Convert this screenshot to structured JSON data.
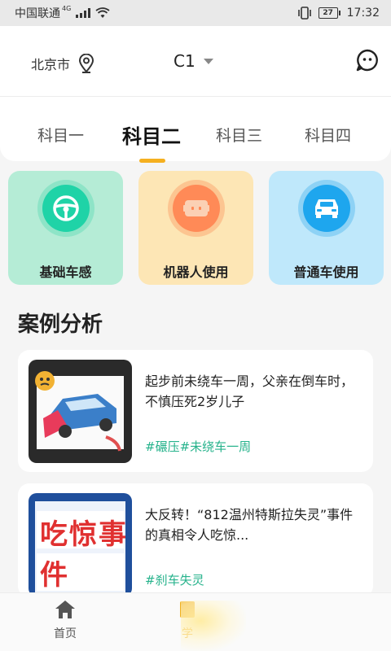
{
  "status_bar": {
    "carrier": "中国联通",
    "network": "4G",
    "battery": "27",
    "time": "17:32"
  },
  "header": {
    "city": "北京市",
    "license_type": "C1",
    "icons": {
      "location": "location-pin-icon",
      "dropdown": "caret-down-icon",
      "chat": "chat-bubble-icon"
    }
  },
  "tabs": [
    {
      "label": "科目一",
      "active": false
    },
    {
      "label": "科目二",
      "active": true
    },
    {
      "label": "科目三",
      "active": false
    },
    {
      "label": "科目四",
      "active": false
    }
  ],
  "categories": [
    {
      "label": "基础车感",
      "icon": "steering-wheel-icon",
      "color": "#1fd3a7"
    },
    {
      "label": "机器人使用",
      "icon": "robot-icon",
      "color": "#ff8a57"
    },
    {
      "label": "普通车使用",
      "icon": "car-icon",
      "color": "#1ea6ee"
    }
  ],
  "section": {
    "title": "案例分析"
  },
  "articles": [
    {
      "title": "起步前未绕车一周，父亲在倒车时，不慎压死2岁儿子",
      "tags": "#碾压#未绕车一周"
    },
    {
      "title": "大反转！“812温州特斯拉失灵”事件的真相令人吃惊...",
      "tags": "#刹车失灵",
      "thumb_text": "吃惊事件"
    }
  ],
  "bottom_nav": [
    {
      "label": "首页",
      "icon": "home-icon"
    },
    {
      "label": "学",
      "icon": "study-icon"
    }
  ],
  "colors": {
    "accent": "#f5b020",
    "tag": "#27b38c"
  }
}
